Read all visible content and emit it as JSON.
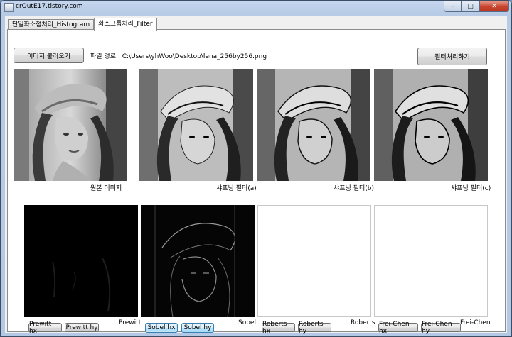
{
  "window": {
    "title": "crOutE17.tistory.com",
    "caption": {
      "minimize": "–",
      "maximize": "□",
      "close": "✕"
    }
  },
  "tabs": [
    {
      "label": "단일화소점처리_Histogram",
      "active": false
    },
    {
      "label": "화소그룹처리_Filter",
      "active": true
    }
  ],
  "toolbar": {
    "load_button": "이미지 불러오기",
    "file_path_label": "파일 경로 : C:\\Users\\yhWoo\\Desktop\\lena_256by256.png",
    "filter_button": "필터처리하기"
  },
  "images_top": [
    {
      "caption": "원본 이미지"
    },
    {
      "caption": "샤프닝 필터(a)"
    },
    {
      "caption": "샤프닝 필터(b)"
    },
    {
      "caption": "샤프닝 필터(c)"
    }
  ],
  "edge_groups": [
    {
      "name": "Prewitt",
      "buttons": [
        "Prewitt hx",
        "Prewitt hy"
      ]
    },
    {
      "name": "Sobel",
      "buttons": [
        "Sobel hx",
        "Sobel hy"
      ]
    },
    {
      "name": "Roberts",
      "buttons": [
        "Roberts hx",
        "Roberts hy"
      ]
    },
    {
      "name": "Frei-Chen",
      "buttons": [
        "Frei-Chen hx",
        "Frei-Chen hy"
      ]
    }
  ]
}
